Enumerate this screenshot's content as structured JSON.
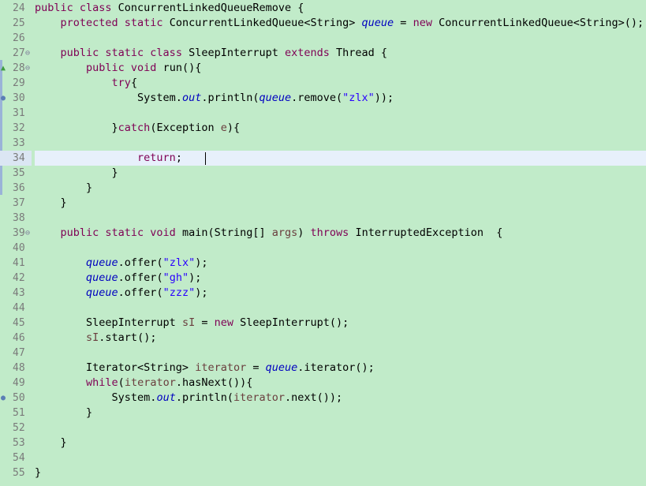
{
  "editor": {
    "first_line_number": 24,
    "current_line_number": 34,
    "markers": {
      "override_icon_line": 28,
      "breakpoint_lines": [
        30,
        50
      ],
      "fold_lines": [
        27,
        28,
        39
      ]
    },
    "lines": [
      [
        {
          "t": "public class ",
          "c": "kw"
        },
        {
          "t": "ConcurrentLinkedQueueRemove {"
        }
      ],
      [
        {
          "t": "    "
        },
        {
          "t": "protected static ",
          "c": "kw"
        },
        {
          "t": "ConcurrentLinkedQueue<String> "
        },
        {
          "t": "queue",
          "c": "fld"
        },
        {
          "t": " = "
        },
        {
          "t": "new ",
          "c": "kw"
        },
        {
          "t": "ConcurrentLinkedQueue<String>();"
        }
      ],
      [],
      [
        {
          "t": "    "
        },
        {
          "t": "public static class ",
          "c": "kw"
        },
        {
          "t": "SleepInterrupt "
        },
        {
          "t": "extends ",
          "c": "kw"
        },
        {
          "t": "Thread {"
        }
      ],
      [
        {
          "t": "        "
        },
        {
          "t": "public void ",
          "c": "kw"
        },
        {
          "t": "run(){"
        }
      ],
      [
        {
          "t": "            "
        },
        {
          "t": "try",
          "c": "kw"
        },
        {
          "t": "{"
        }
      ],
      [
        {
          "t": "                System."
        },
        {
          "t": "out",
          "c": "fld"
        },
        {
          "t": ".println("
        },
        {
          "t": "queue",
          "c": "fld"
        },
        {
          "t": ".remove("
        },
        {
          "t": "\"zlx\"",
          "c": "str"
        },
        {
          "t": "));"
        }
      ],
      [],
      [
        {
          "t": "            }"
        },
        {
          "t": "catch",
          "c": "kw"
        },
        {
          "t": "(Exception "
        },
        {
          "t": "e",
          "c": "var"
        },
        {
          "t": "){"
        }
      ],
      [],
      [
        {
          "t": "                "
        },
        {
          "t": "return",
          "c": "kw"
        },
        {
          "t": ";"
        }
      ],
      [
        {
          "t": "            }"
        }
      ],
      [
        {
          "t": "        }"
        }
      ],
      [
        {
          "t": "    }"
        }
      ],
      [],
      [
        {
          "t": "    "
        },
        {
          "t": "public static void ",
          "c": "kw"
        },
        {
          "t": "main(String[] "
        },
        {
          "t": "args",
          "c": "var"
        },
        {
          "t": ") "
        },
        {
          "t": "throws ",
          "c": "kw"
        },
        {
          "t": "InterruptedException  {"
        }
      ],
      [],
      [
        {
          "t": "        "
        },
        {
          "t": "queue",
          "c": "fld"
        },
        {
          "t": ".offer("
        },
        {
          "t": "\"zlx\"",
          "c": "str"
        },
        {
          "t": ");"
        }
      ],
      [
        {
          "t": "        "
        },
        {
          "t": "queue",
          "c": "fld"
        },
        {
          "t": ".offer("
        },
        {
          "t": "\"gh\"",
          "c": "str"
        },
        {
          "t": ");"
        }
      ],
      [
        {
          "t": "        "
        },
        {
          "t": "queue",
          "c": "fld"
        },
        {
          "t": ".offer("
        },
        {
          "t": "\"zzz\"",
          "c": "str"
        },
        {
          "t": ");"
        }
      ],
      [],
      [
        {
          "t": "        SleepInterrupt "
        },
        {
          "t": "sI",
          "c": "var"
        },
        {
          "t": " = "
        },
        {
          "t": "new ",
          "c": "kw"
        },
        {
          "t": "SleepInterrupt();"
        }
      ],
      [
        {
          "t": "        "
        },
        {
          "t": "sI",
          "c": "var"
        },
        {
          "t": ".start();"
        }
      ],
      [],
      [
        {
          "t": "        Iterator<String> "
        },
        {
          "t": "iterator",
          "c": "var"
        },
        {
          "t": " = "
        },
        {
          "t": "queue",
          "c": "fld"
        },
        {
          "t": ".iterator();"
        }
      ],
      [
        {
          "t": "        "
        },
        {
          "t": "while",
          "c": "kw"
        },
        {
          "t": "("
        },
        {
          "t": "iterator",
          "c": "var"
        },
        {
          "t": ".hasNext()){"
        }
      ],
      [
        {
          "t": "            System."
        },
        {
          "t": "out",
          "c": "fld"
        },
        {
          "t": ".println("
        },
        {
          "t": "iterator",
          "c": "var"
        },
        {
          "t": ".next());"
        }
      ],
      [
        {
          "t": "        }"
        }
      ],
      [],
      [
        {
          "t": "    }"
        }
      ],
      [],
      [
        {
          "t": "}"
        }
      ]
    ]
  },
  "colors": {
    "background": "#c1ebc9",
    "current_line": "#e7f0fb",
    "keyword": "#7f0055",
    "field": "#0000c0",
    "string": "#2a00ff",
    "local_variable": "#6a3e3e",
    "line_number": "#7a7a7a",
    "breakpoint": "#5b7fb5",
    "override_marker": "#3f9d3f"
  },
  "icons": {
    "breakpoint": "breakpoint-dot-icon",
    "override": "override-triangle-icon",
    "fold": "fold-minus-icon"
  }
}
